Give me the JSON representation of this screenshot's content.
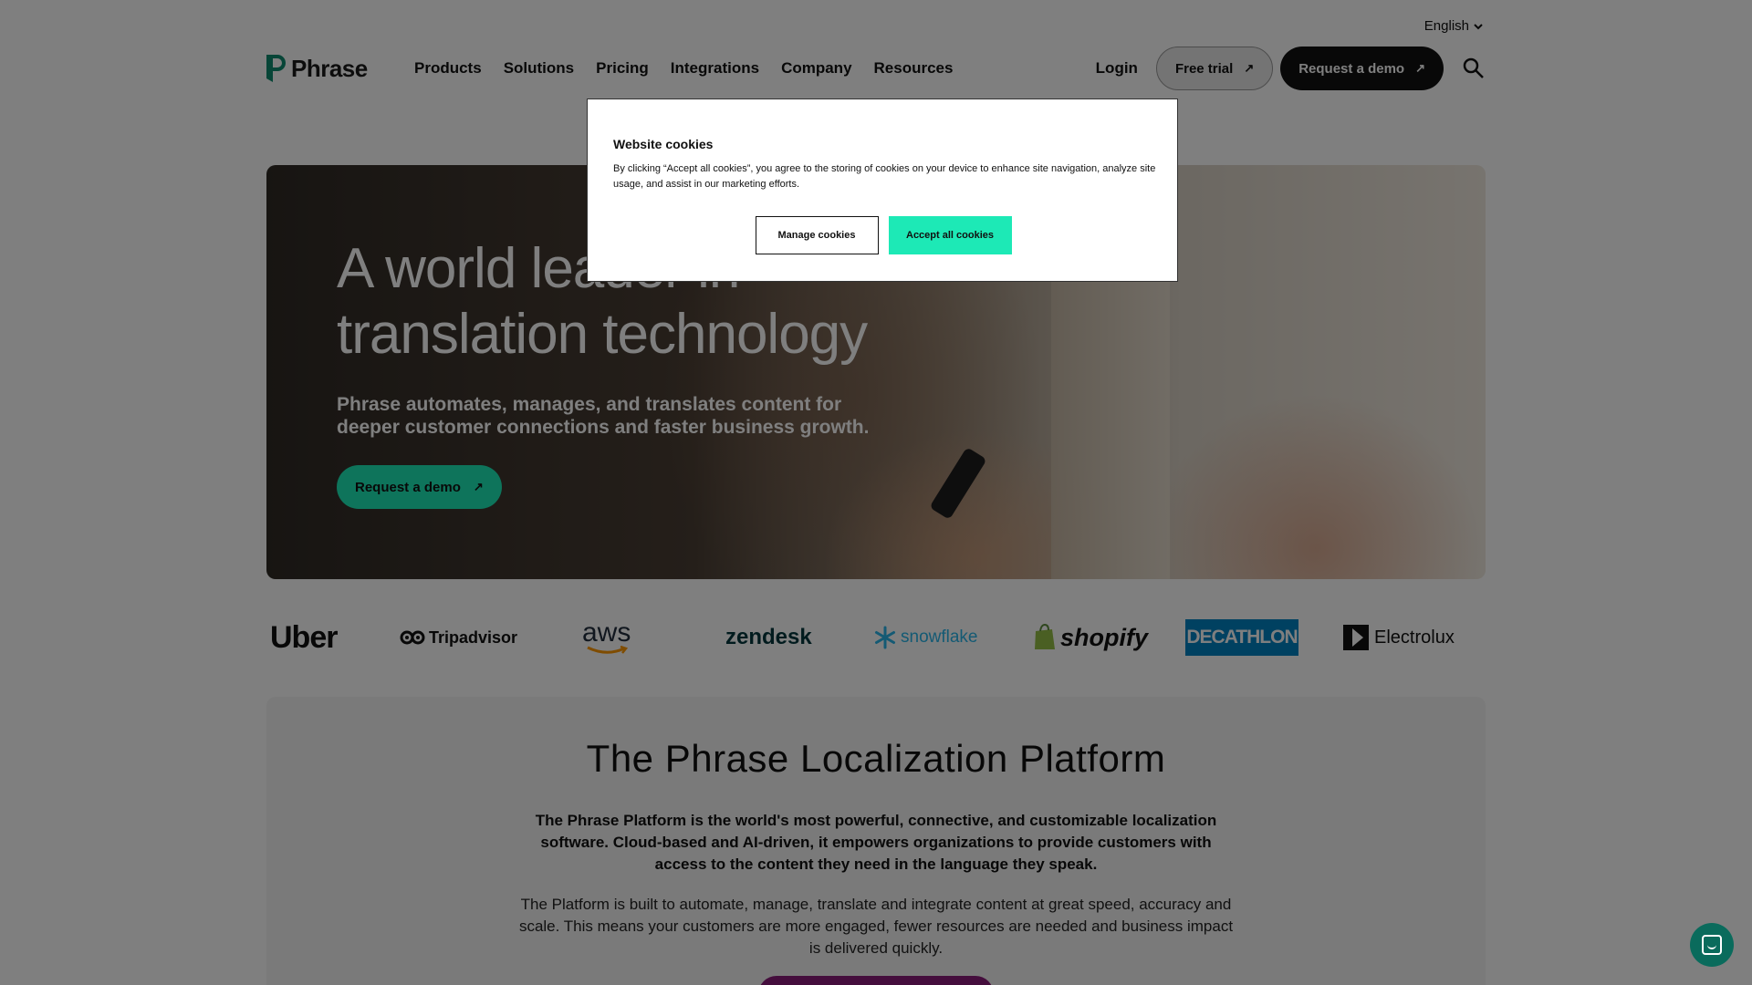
{
  "language": {
    "label": "English"
  },
  "header": {
    "logo_text": "Phrase",
    "nav": [
      "Products",
      "Solutions",
      "Pricing",
      "Integrations",
      "Company",
      "Resources"
    ],
    "login": "Login",
    "free_trial": "Free trial",
    "request_demo": "Request a demo",
    "arrow": "↗"
  },
  "hero": {
    "title": "A world leader in translation technology",
    "subtitle": "Phrase automates, manages, and translates content for deeper customer connections and faster business growth.",
    "cta": "Request a demo"
  },
  "logos": {
    "uber": "Uber",
    "tripadvisor": "Tripadvisor",
    "aws": "aws",
    "zendesk": "zendesk",
    "snowflake": "snowflake",
    "shopify": "shopify",
    "decathlon": "DECATHLON",
    "electrolux": "Electrolux"
  },
  "platform": {
    "title": "The Phrase Localization Platform",
    "lead": "The Phrase Platform is the world's most powerful, connective, and customizable localization software. Cloud-based and AI-driven, it empowers organizations to provide customers with access to the content they need in the language they speak.",
    "body": "The Platform is built to automate, manage, translate and integrate content at great speed, accuracy and scale. This means your customers are more engaged, fewer resources are needed and business impact is delivered quickly."
  },
  "cookie_modal": {
    "title": "Website cookies",
    "text": "By clicking “Accept all cookies”, you agree to the storing of cookies on your device to enhance site navigation, analyze site usage, and assist in our marketing efforts.",
    "manage": "Manage cookies",
    "accept": "Accept all cookies"
  },
  "colors": {
    "accent": "#1de9b6",
    "dark": "#111111",
    "chat": "#0a6b5c"
  }
}
